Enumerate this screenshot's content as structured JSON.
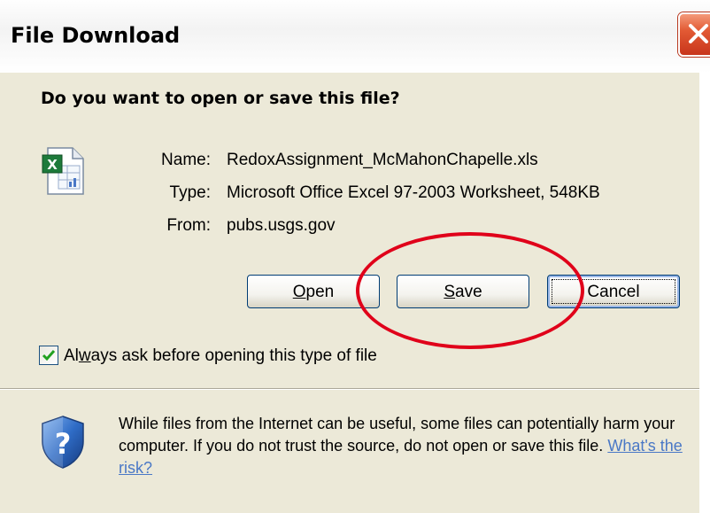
{
  "dialog": {
    "title": "File Download",
    "question": "Do you want to open or save this file?",
    "close_icon": "close-icon"
  },
  "file": {
    "icon": "excel-file-icon",
    "name_label": "Name:",
    "name_value": "RedoxAssignment_McMahonChapelle.xls",
    "type_label": "Type:",
    "type_value": "Microsoft Office Excel 97-2003 Worksheet, 548KB",
    "from_label": "From:",
    "from_value": "pubs.usgs.gov"
  },
  "buttons": {
    "open_first": "O",
    "open_rest": "pen",
    "save_first": "S",
    "save_rest": "ave",
    "cancel": "Cancel"
  },
  "checkbox": {
    "checked": true,
    "label_before": "Al",
    "label_underlined": "w",
    "label_after": "ays ask before opening this type of file"
  },
  "warning": {
    "icon": "shield-question-icon",
    "text": "While files from the Internet can be useful, some files can potentially harm your computer. If you do not trust the source, do not open or save this file.",
    "link": "What's the risk?"
  },
  "colors": {
    "annotation": "#e0001a",
    "link": "#4a78c6",
    "dialog_bg": "#ece9d8"
  }
}
